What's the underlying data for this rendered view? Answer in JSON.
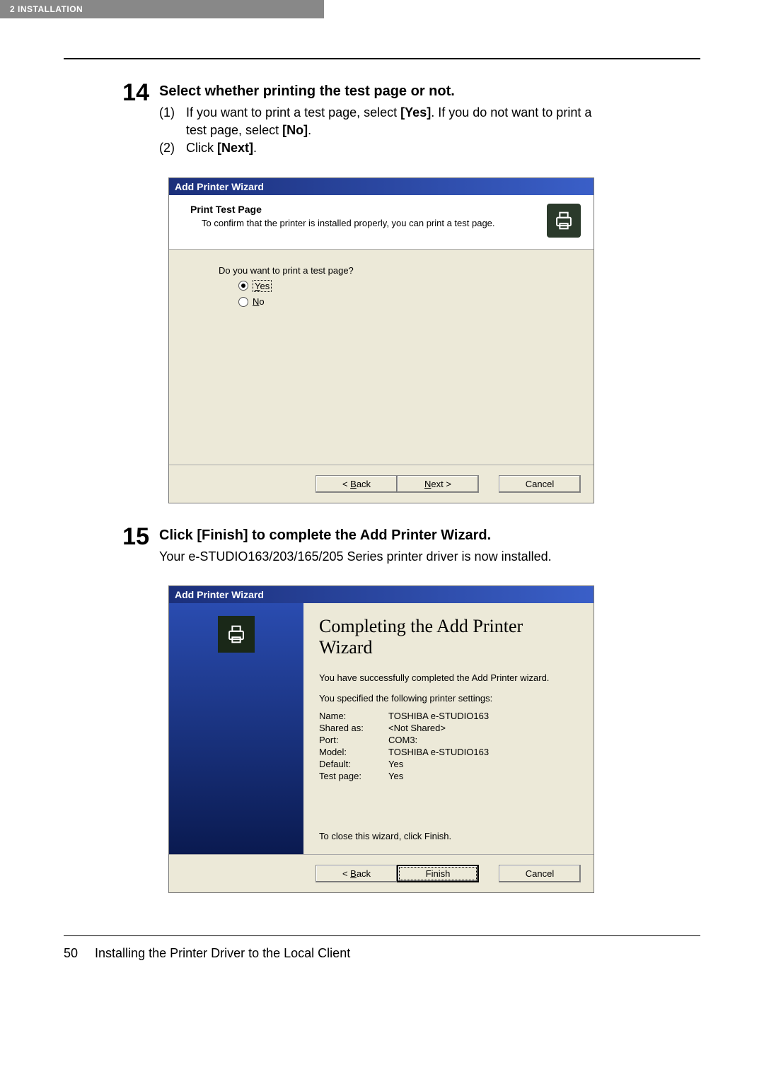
{
  "header": {
    "tab": "2   INSTALLATION"
  },
  "step14": {
    "num": "14",
    "title": "Select whether printing the test page or not.",
    "line1_num": "(1)",
    "line1_a": "If you want to print a test page, select ",
    "line1_bold1": "[Yes]",
    "line1_b": ". If you do not want to print a test page, select ",
    "line1_bold2": "[No]",
    "line1_c": ".",
    "line2_num": "(2)",
    "line2_a": "Click ",
    "line2_bold": "[Next]",
    "line2_b": "."
  },
  "wizard1": {
    "titlebar": "Add Printer Wizard",
    "header_title": "Print Test Page",
    "header_sub": "To confirm that the printer is installed properly, you can print a test page.",
    "question": "Do you want to print a test page?",
    "yes_pre": "Y",
    "yes_rest": "es",
    "no_pre": "N",
    "no_rest": "o",
    "back_pre": "< ",
    "back_u": "B",
    "back_rest": "ack",
    "next_u": "N",
    "next_rest": "ext >",
    "cancel": "Cancel"
  },
  "step15": {
    "num": "15",
    "title": "Click [Finish] to complete the Add Printer Wizard.",
    "body": "Your e-STUDIO163/203/165/205 Series printer driver is now installed."
  },
  "wizard2": {
    "titlebar": "Add Printer Wizard",
    "big_title": "Completing the Add Printer Wizard",
    "msg1": "You have successfully completed the Add Printer wizard.",
    "msg2": "You specified the following printer settings:",
    "settings": {
      "name_k": "Name:",
      "name_v": "TOSHIBA e-STUDIO163",
      "shared_k": "Shared as:",
      "shared_v": "<Not Shared>",
      "port_k": "Port:",
      "port_v": "COM3:",
      "model_k": "Model:",
      "model_v": "TOSHIBA e-STUDIO163",
      "default_k": "Default:",
      "default_v": "Yes",
      "test_k": "Test page:",
      "test_v": "Yes"
    },
    "close_msg": "To close this wizard, click Finish.",
    "back_pre": "< ",
    "back_u": "B",
    "back_rest": "ack",
    "finish": "Finish",
    "cancel": "Cancel"
  },
  "footer": {
    "page": "50",
    "text": "Installing the Printer Driver to the Local Client"
  }
}
